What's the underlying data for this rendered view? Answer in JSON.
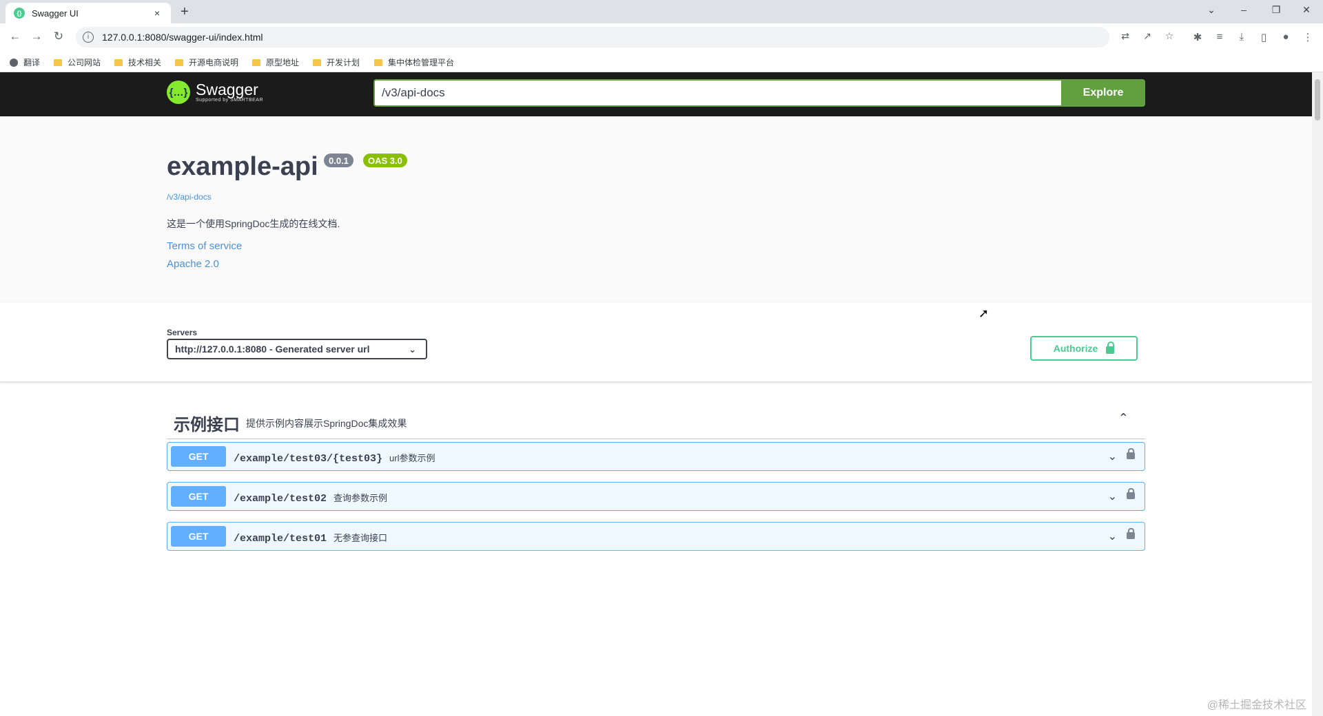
{
  "browser": {
    "tab_title": "Swagger UI",
    "tab_close": "×",
    "new_tab": "+",
    "url": "127.0.0.1:8080/swagger-ui/index.html",
    "win_minimize": "–",
    "win_restore": "❐",
    "win_close": "✕",
    "tab_list": "⌄",
    "back": "←",
    "forward": "→",
    "reload": "↻",
    "info": "i",
    "bookmarks": [
      "翻译",
      "公司网站",
      "技术相关",
      "开源电商说明",
      "原型地址",
      "开发计划",
      "集中体检管理平台"
    ]
  },
  "swagger": {
    "logo_mark": "{…}",
    "logo_name": "Swagger",
    "logo_sub": "Supported by SMARTBEAR",
    "spec_url": "/v3/api-docs",
    "explore_label": "Explore",
    "api_title": "example-api",
    "version": "0.0.1",
    "oas": "OAS 3.0",
    "spec_link": "/v3/api-docs",
    "description": "这是一个使用SpringDoc生成的在线文档.",
    "terms": "Terms of service",
    "license": "Apache 2.0",
    "servers_label": "Servers",
    "server_selected": "http://127.0.0.1:8080 - Generated server url",
    "authorize_label": "Authorize",
    "tag": {
      "name": "示例接口",
      "description": "提供示例内容展示SpringDoc集成效果",
      "toggle": "⌃"
    },
    "operations": [
      {
        "method": "GET",
        "path": "/example/test03/{test03}",
        "summary": "url参数示例"
      },
      {
        "method": "GET",
        "path": "/example/test02",
        "summary": "查询参数示例"
      },
      {
        "method": "GET",
        "path": "/example/test01",
        "summary": "无参查询接口"
      }
    ],
    "op_chevron": "⌄"
  },
  "watermark": "@稀土掘金技术社区",
  "colors": {
    "get": "#61affe",
    "explore": "#62a03f",
    "authorize": "#49cc90",
    "topbar": "#1b1b1b"
  }
}
